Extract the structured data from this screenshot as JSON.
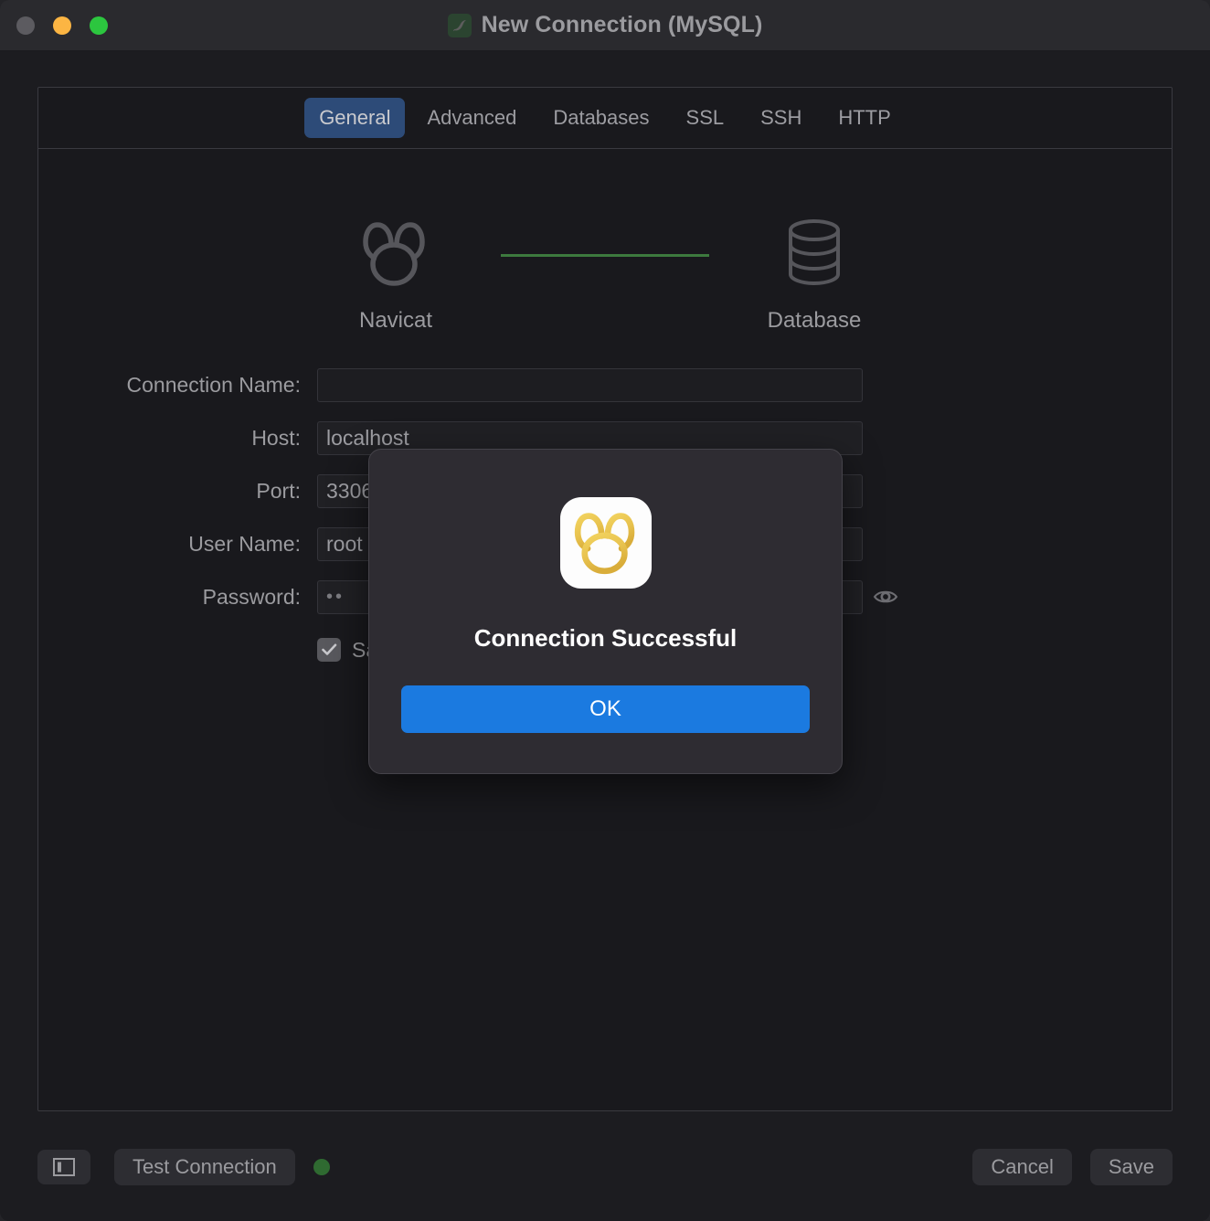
{
  "window": {
    "title": "New Connection (MySQL)",
    "title_icon": "mysql-dolphin-icon",
    "traffic_lights": [
      "close",
      "minimize",
      "maximize"
    ]
  },
  "tabs": [
    {
      "label": "General",
      "active": true
    },
    {
      "label": "Advanced",
      "active": false
    },
    {
      "label": "Databases",
      "active": false
    },
    {
      "label": "SSL",
      "active": false
    },
    {
      "label": "SSH",
      "active": false
    },
    {
      "label": "HTTP",
      "active": false
    }
  ],
  "diagram": {
    "left_label": "Navicat",
    "left_icon": "navicat-logo-icon",
    "right_label": "Database",
    "right_icon": "database-cylinder-icon",
    "link_color": "#3d7a3e"
  },
  "form": {
    "connection_name": {
      "label": "Connection Name:",
      "value": "",
      "placeholder": ""
    },
    "host": {
      "label": "Host:",
      "value": "localhost"
    },
    "port": {
      "label": "Port:",
      "value": "3306"
    },
    "user_name": {
      "label": "User Name:",
      "value": "root"
    },
    "password": {
      "label": "Password:",
      "value": "••",
      "reveal_icon": "eye-icon"
    },
    "save_password": {
      "label": "Save password",
      "checked": true
    }
  },
  "footer": {
    "sidebar_toggle_icon": "sidebar-panel-icon",
    "test_connection_label": "Test Connection",
    "status_dot_color": "#2f6a31",
    "cancel_label": "Cancel",
    "save_label": "Save"
  },
  "modal": {
    "icon": "navicat-app-icon",
    "title": "Connection Successful",
    "ok_label": "OK",
    "accent_color": "#1b7ae0"
  }
}
